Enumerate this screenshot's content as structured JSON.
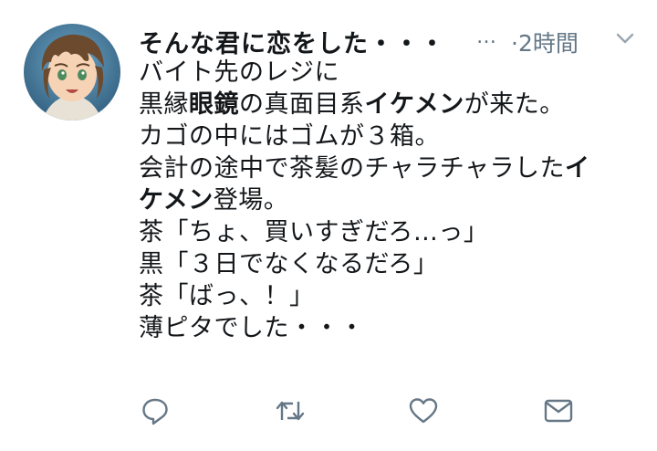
{
  "tweet": {
    "display_name": "そんな君に恋をした・・・",
    "name_ellipsis": "…",
    "timestamp": "·2時間",
    "lines": [
      {
        "segments": [
          "バイト先のレジに"
        ]
      },
      {
        "segments": [
          "黒縁",
          "眼鏡",
          "の真面目系",
          "イケメン",
          "が来た。"
        ]
      },
      {
        "segments": [
          "カゴの中にはゴムが３箱。"
        ]
      },
      {
        "segments": [
          "会計の途中で茶髪のチャラチャラした",
          "イ"
        ]
      },
      {
        "segments": [
          "ケメン",
          "登場。"
        ]
      },
      {
        "segments": [
          "茶「ちょ、買いすぎだろ…っ」"
        ]
      },
      {
        "segments": [
          "黒「３日でなくなるだろ」"
        ]
      },
      {
        "segments": [
          "茶「ばっ、！」"
        ]
      },
      {
        "segments": [
          "薄ピタでした・・・"
        ]
      }
    ]
  },
  "icons": {
    "reply": "reply-icon",
    "retweet": "retweet-icon",
    "like": "heart-icon",
    "dm": "envelope-icon",
    "menu": "chevron-down-icon"
  },
  "colors": {
    "text": "#14171a",
    "secondary": "#657786",
    "background": "#ffffff"
  }
}
